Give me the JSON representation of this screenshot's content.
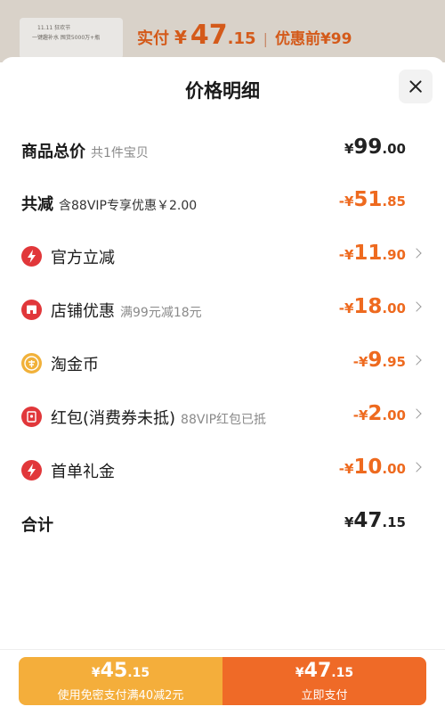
{
  "header_preview": {
    "thumb_line1": "11.11 狂欢节",
    "thumb_line2": "一键趣补水 囤货5000万+瓶",
    "paid_label": "实付",
    "paid_yen": "¥",
    "paid_int": "47",
    "paid_dec": ".15",
    "separator": "|",
    "before_label": "优惠前¥99"
  },
  "sheet": {
    "title": "价格明细",
    "close_icon": "close-icon"
  },
  "rows": {
    "total": {
      "label": "商品总价",
      "sub": "共1件宝贝",
      "yen": "¥",
      "int": "99",
      "dec": ".00"
    },
    "discount": {
      "label": "共减",
      "sub": "含88VIP专享优惠￥2.00",
      "yen": "-¥",
      "int": "51",
      "dec": ".85"
    },
    "official": {
      "label": "官方立减",
      "icon": "lightning-icon",
      "yen": "-¥",
      "int": "11",
      "dec": ".90"
    },
    "shop": {
      "label": "店铺优惠",
      "sub": "满99元减18元",
      "icon": "shop-icon",
      "yen": "-¥",
      "int": "18",
      "dec": ".00"
    },
    "coin": {
      "label": "淘金币",
      "icon": "coin-icon",
      "yen": "-¥",
      "int": "9",
      "dec": ".95"
    },
    "redpacket": {
      "label": "红包(消费券未抵)",
      "sub": "88VIP红包已抵",
      "icon": "red-packet-icon",
      "yen": "-¥",
      "int": "2",
      "dec": ".00"
    },
    "firstorder": {
      "label": "首单礼金",
      "icon": "lightning-icon",
      "yen": "-¥",
      "int": "10",
      "dec": ".00"
    },
    "sum": {
      "label": "合计",
      "yen": "¥",
      "int": "47",
      "dec": ".15"
    }
  },
  "pay": {
    "left": {
      "yen": "¥",
      "int": "45",
      "dec": ".15",
      "sub": "使用免密支付满40减2元"
    },
    "right": {
      "yen": "¥",
      "int": "47",
      "dec": ".15",
      "sub": "立即支付"
    }
  },
  "colors": {
    "accent_orange": "#ee6a1f",
    "pay_left": "#f4ae3b",
    "pay_right": "#ef6a27",
    "icon_red": "#e1373a",
    "icon_coin": "#f1b13a"
  }
}
